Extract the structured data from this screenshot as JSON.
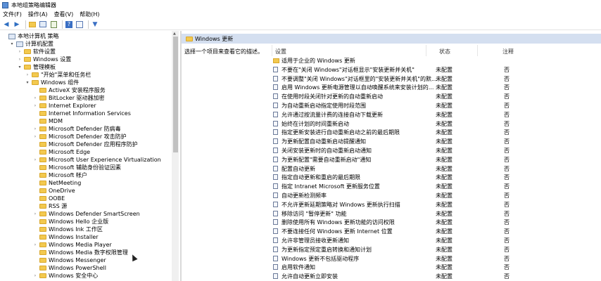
{
  "window": {
    "title": "本地组策略编辑器"
  },
  "menu": [
    "文件(F)",
    "操作(A)",
    "查看(V)",
    "帮助(H)"
  ],
  "toolbar": [
    "back-arrow-icon",
    "forward-arrow-icon",
    "folder-up-icon",
    "show-hide-tree-icon",
    "export-icon",
    "help-icon",
    "properties-icon",
    "filter-icon"
  ],
  "tree": [
    {
      "label": "本地计算机 策略",
      "indent": 0,
      "twisty": "",
      "icon": "computer"
    },
    {
      "label": "计算机配置",
      "indent": 1,
      "twisty": "▾",
      "icon": "computer"
    },
    {
      "label": "软件设置",
      "indent": 2,
      "twisty": "›",
      "icon": "folder"
    },
    {
      "label": "Windows 设置",
      "indent": 2,
      "twisty": "›",
      "icon": "folder"
    },
    {
      "label": "管理模板",
      "indent": 2,
      "twisty": "▾",
      "icon": "folder"
    },
    {
      "label": "\"开始\"菜单和任务栏",
      "indent": 3,
      "twisty": "›",
      "icon": "folder"
    },
    {
      "label": "Windows 组件",
      "indent": 3,
      "twisty": "▾",
      "icon": "folder"
    },
    {
      "label": "ActiveX 安装程序服务",
      "indent": 4,
      "twisty": "",
      "icon": "folder"
    },
    {
      "label": "BitLocker 驱动器加密",
      "indent": 4,
      "twisty": "›",
      "icon": "folder"
    },
    {
      "label": "Internet Explorer",
      "indent": 4,
      "twisty": "›",
      "icon": "folder"
    },
    {
      "label": "Internet Information Services",
      "indent": 4,
      "twisty": "",
      "icon": "folder"
    },
    {
      "label": "MDM",
      "indent": 4,
      "twisty": "",
      "icon": "folder"
    },
    {
      "label": "Microsoft Defender 防病毒",
      "indent": 4,
      "twisty": "›",
      "icon": "folder"
    },
    {
      "label": "Microsoft Defender 攻击防护",
      "indent": 4,
      "twisty": "›",
      "icon": "folder"
    },
    {
      "label": "Microsoft Defender 应用程序防护",
      "indent": 4,
      "twisty": "",
      "icon": "folder"
    },
    {
      "label": "Microsoft Edge",
      "indent": 4,
      "twisty": "",
      "icon": "folder"
    },
    {
      "label": "Microsoft User Experience Virtualization",
      "indent": 4,
      "twisty": "›",
      "icon": "folder"
    },
    {
      "label": "Microsoft 辅助身份验证因素",
      "indent": 4,
      "twisty": "",
      "icon": "folder"
    },
    {
      "label": "Microsoft 帐户",
      "indent": 4,
      "twisty": "",
      "icon": "folder"
    },
    {
      "label": "NetMeeting",
      "indent": 4,
      "twisty": "",
      "icon": "folder"
    },
    {
      "label": "OneDrive",
      "indent": 4,
      "twisty": "",
      "icon": "folder"
    },
    {
      "label": "OOBE",
      "indent": 4,
      "twisty": "",
      "icon": "folder"
    },
    {
      "label": "RSS 源",
      "indent": 4,
      "twisty": "",
      "icon": "folder"
    },
    {
      "label": "Windows Defender SmartScreen",
      "indent": 4,
      "twisty": "›",
      "icon": "folder"
    },
    {
      "label": "Windows Hello 企业版",
      "indent": 4,
      "twisty": "",
      "icon": "folder"
    },
    {
      "label": "Windows Ink 工作区",
      "indent": 4,
      "twisty": "",
      "icon": "folder"
    },
    {
      "label": "Windows Installer",
      "indent": 4,
      "twisty": "",
      "icon": "folder"
    },
    {
      "label": "Windows Media Player",
      "indent": 4,
      "twisty": "›",
      "icon": "folder"
    },
    {
      "label": "Windows Media 数字权限管理",
      "indent": 4,
      "twisty": "",
      "icon": "folder"
    },
    {
      "label": "Windows Messenger",
      "indent": 4,
      "twisty": "",
      "icon": "folder"
    },
    {
      "label": "Windows PowerShell",
      "indent": 4,
      "twisty": "",
      "icon": "folder"
    },
    {
      "label": "Windows 安全中心",
      "indent": 4,
      "twisty": "›",
      "icon": "folder"
    }
  ],
  "right": {
    "header": "Windows 更新",
    "description": "选择一个项目来查看它的描述。",
    "columns": {
      "setting": "设置",
      "state": "状态",
      "note": "注释"
    },
    "rows": [
      {
        "name": "适用于企业的 Windows 更新",
        "state": "",
        "note": "",
        "folder": true
      },
      {
        "name": "不要在\"关闭 Windows\"对话框显示\"安装更新并关机\"",
        "state": "未配置",
        "note": "否"
      },
      {
        "name": "不要调整\"关闭 Windows\"对话框里的\"安装更新并关机\"的默...",
        "state": "未配置",
        "note": "否"
      },
      {
        "name": "启用 Windows 更新电源管理以自动唤醒系统来安装计划的...",
        "state": "未配置",
        "note": "否"
      },
      {
        "name": "在使用时段关闭针对更新的自动重新启动",
        "state": "未配置",
        "note": "否"
      },
      {
        "name": "为自动重新启动指定使用时段范围",
        "state": "未配置",
        "note": "否"
      },
      {
        "name": "允许通过按流量计费的连接自动下载更新",
        "state": "未配置",
        "note": "否"
      },
      {
        "name": "始终在计划的时间重新启动",
        "state": "未配置",
        "note": "否"
      },
      {
        "name": "指定更新安装进行自动重新启动之前的最后期限",
        "state": "未配置",
        "note": "否"
      },
      {
        "name": "为更新配置自动重新启动提醒通知",
        "state": "未配置",
        "note": "否"
      },
      {
        "name": "关闭安装更新时的自动重新启动通知",
        "state": "未配置",
        "note": "否"
      },
      {
        "name": "为更新配置\"需要自动重新启动\"通知",
        "state": "未配置",
        "note": "否"
      },
      {
        "name": "配置自动更新",
        "state": "未配置",
        "note": "否"
      },
      {
        "name": "指定自动更新和重启的最后期限",
        "state": "未配置",
        "note": "否"
      },
      {
        "name": "指定 Intranet Microsoft 更新服务位置",
        "state": "未配置",
        "note": "否"
      },
      {
        "name": "自动更新检测频率",
        "state": "未配置",
        "note": "否"
      },
      {
        "name": "不允许更新延期策略对 Windows 更新执行扫描",
        "state": "未配置",
        "note": "否"
      },
      {
        "name": "移除访问 \"暂停更新\" 功能",
        "state": "未配置",
        "note": "否"
      },
      {
        "name": "删除使用所有 Windows 更新功能的访问权限",
        "state": "未配置",
        "note": "否"
      },
      {
        "name": "不要连接任何 Windows 更新 Internet 位置",
        "state": "未配置",
        "note": "否"
      },
      {
        "name": "允许非管理员接收更新通知",
        "state": "未配置",
        "note": "否"
      },
      {
        "name": "为更新指定预定重启转换和通知计划",
        "state": "未配置",
        "note": "否"
      },
      {
        "name": "Windows 更新不包括驱动程序",
        "state": "未配置",
        "note": "否"
      },
      {
        "name": "启用软件通知",
        "state": "未配置",
        "note": "否"
      },
      {
        "name": "允许自动更新立即安装",
        "state": "未配置",
        "note": "否"
      }
    ]
  }
}
